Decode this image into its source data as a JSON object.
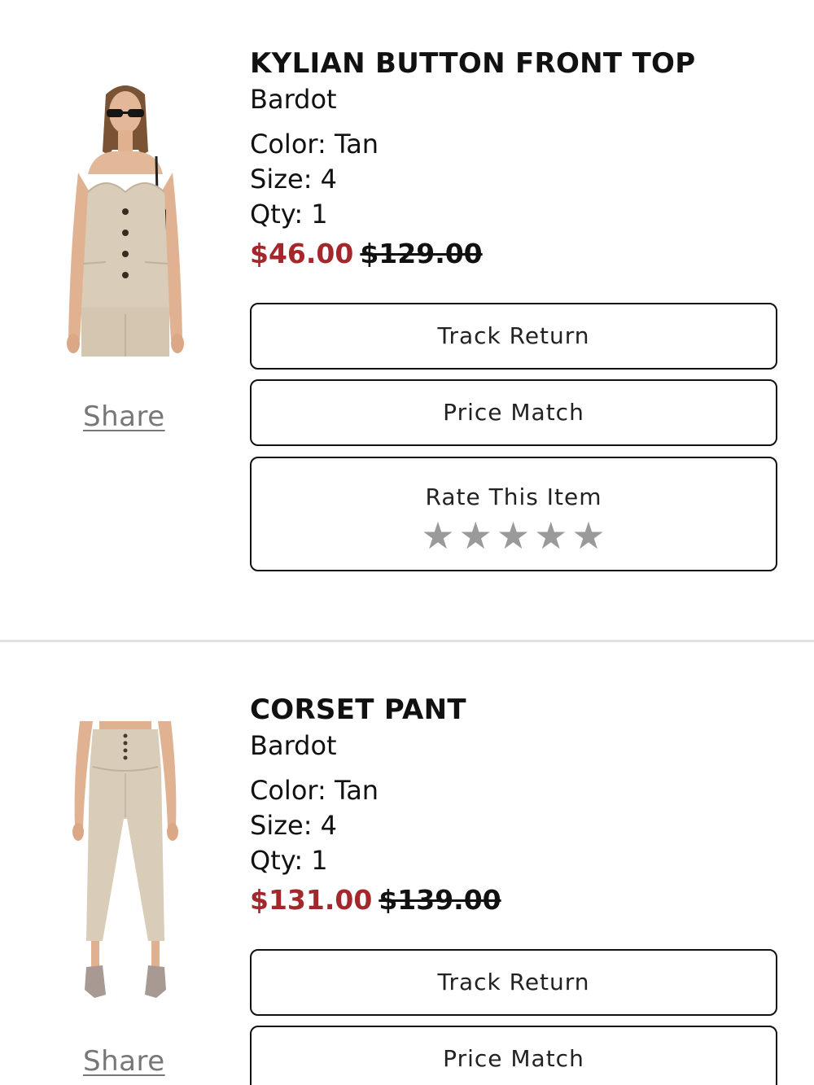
{
  "items": [
    {
      "name": "KYLIAN BUTTON FRONT TOP",
      "brand": "Bardot",
      "color": "Color: Tan",
      "size": "Size: 4",
      "qty": "Qty: 1",
      "sale_price": "$46.00",
      "original_price": "$129.00",
      "share_label": "Share",
      "track_return_label": "Track Return",
      "price_match_label": "Price Match",
      "rate_label": "Rate This Item",
      "star_glyph": "★",
      "rating_selected": 0,
      "rating_max": 5
    },
    {
      "name": "CORSET PANT",
      "brand": "Bardot",
      "color": "Color: Tan",
      "size": "Size: 4",
      "qty": "Qty: 1",
      "sale_price": "$131.00",
      "original_price": "$139.00",
      "share_label": "Share",
      "track_return_label": "Track Return",
      "price_match_label": "Price Match"
    }
  ],
  "colors": {
    "sale_price": "#a4272b",
    "star_empty": "#9a9a9a",
    "share_link": "#777777",
    "product_tan": "#d9ccb8"
  }
}
